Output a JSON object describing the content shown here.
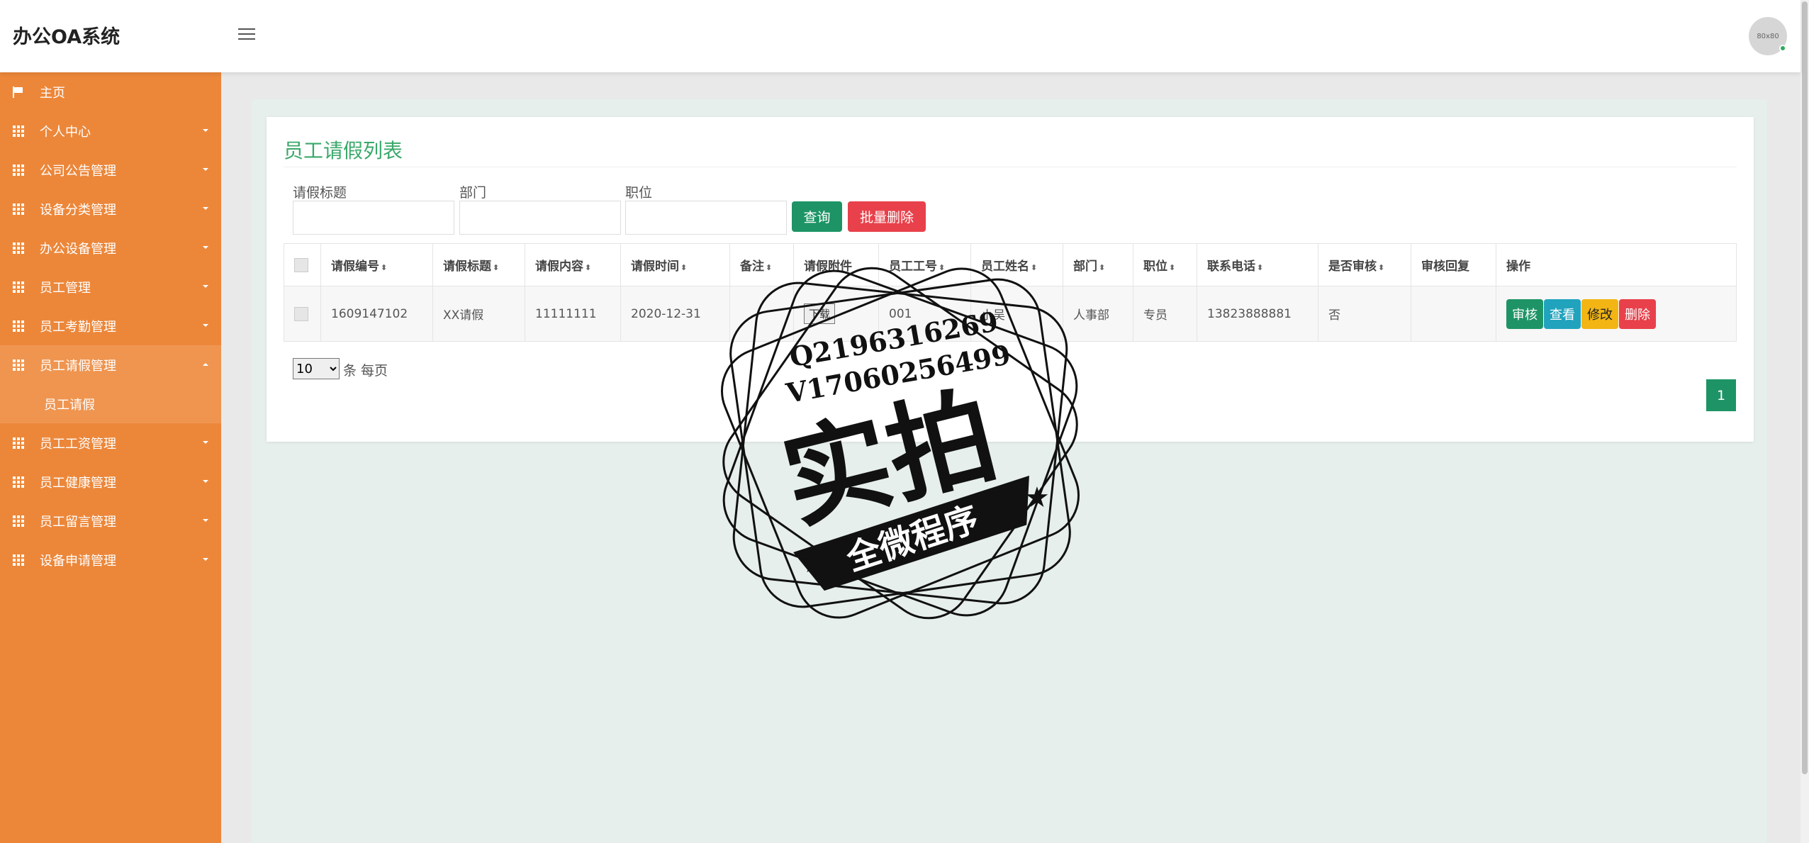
{
  "header": {
    "app_title": "办公OA系统",
    "avatar_text": "80x80"
  },
  "sidebar": {
    "home": "主页",
    "items": [
      {
        "label": "个人中心"
      },
      {
        "label": "公司公告管理"
      },
      {
        "label": "设备分类管理"
      },
      {
        "label": "办公设备管理"
      },
      {
        "label": "员工管理"
      },
      {
        "label": "员工考勤管理"
      },
      {
        "label": "员工请假管理"
      },
      {
        "label": "员工工资管理"
      },
      {
        "label": "员工健康管理"
      },
      {
        "label": "员工留言管理"
      },
      {
        "label": "设备申请管理"
      }
    ],
    "active_submenu": "员工请假"
  },
  "page": {
    "title": "员工请假列表",
    "filters": {
      "title_label": "请假标题",
      "dept_label": "部门",
      "position_label": "职位"
    },
    "query_button": "查询",
    "batch_delete_button": "批量删除"
  },
  "table": {
    "columns": [
      "请假编号",
      "请假标题",
      "请假内容",
      "请假时间",
      "备注",
      "请假附件",
      "员工工号",
      "员工姓名",
      "部门",
      "职位",
      "联系电话",
      "是否审核",
      "审核回复",
      "操作"
    ],
    "rows": [
      {
        "leave_no": "1609147102",
        "leave_title": "XX请假",
        "content": "11111111",
        "time": "2020-12-31",
        "remark": "",
        "attachment": "下载",
        "emp_no": "001",
        "emp_name": "小吴",
        "dept": "人事部",
        "position": "专员",
        "phone": "13823888881",
        "audited": "否",
        "reply": ""
      }
    ],
    "actions": {
      "audit": "审核",
      "view": "查看",
      "edit": "修改",
      "delete": "删除"
    }
  },
  "pagination": {
    "page_size": "10",
    "per_page_text": "条 每页",
    "current_page": "1"
  },
  "watermark": {
    "line1": "Q2196316269",
    "line2": "V17060256499",
    "main": "实拍",
    "ribbon": "全微程序"
  },
  "colors": {
    "sidebar": "#ec873a",
    "accent_green": "#1e9466",
    "danger": "#e8414b",
    "info": "#21a3bd",
    "warning": "#f2b514",
    "title_green": "#3aa86a"
  }
}
